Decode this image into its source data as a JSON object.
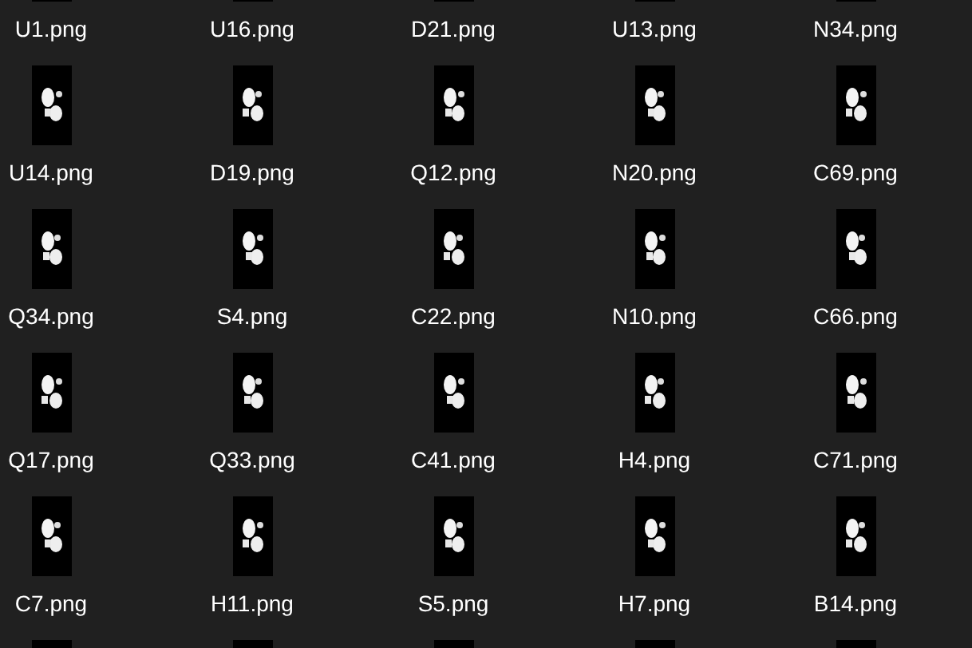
{
  "files": [
    {
      "kind": "file",
      "name": "U1.png"
    },
    {
      "kind": "file",
      "name": "U16.png"
    },
    {
      "kind": "file",
      "name": "D21.png"
    },
    {
      "kind": "file",
      "name": "U13.png"
    },
    {
      "kind": "file",
      "name": "N34.png"
    },
    {
      "kind": "file",
      "name": "U14.png"
    },
    {
      "kind": "file",
      "name": "D19.png"
    },
    {
      "kind": "file",
      "name": "Q12.png"
    },
    {
      "kind": "file",
      "name": "N20.png"
    },
    {
      "kind": "file",
      "name": "C69.png"
    },
    {
      "kind": "file",
      "name": "Q34.png"
    },
    {
      "kind": "file",
      "name": "S4.png"
    },
    {
      "kind": "file",
      "name": "C22.png"
    },
    {
      "kind": "file",
      "name": "N10.png"
    },
    {
      "kind": "file",
      "name": "C66.png"
    },
    {
      "kind": "file",
      "name": "Q17.png"
    },
    {
      "kind": "file",
      "name": "Q33.png"
    },
    {
      "kind": "file",
      "name": "C41.png"
    },
    {
      "kind": "file",
      "name": "H4.png"
    },
    {
      "kind": "file",
      "name": "C71.png"
    },
    {
      "kind": "file",
      "name": "C7.png"
    },
    {
      "kind": "file",
      "name": "H11.png"
    },
    {
      "kind": "file",
      "name": "S5.png"
    },
    {
      "kind": "file",
      "name": "H7.png"
    },
    {
      "kind": "file",
      "name": "B14.png"
    },
    {
      "kind": "picture"
    },
    {
      "kind": "picture"
    },
    {
      "kind": "picture"
    },
    {
      "kind": "picture"
    },
    {
      "kind": "picture"
    }
  ]
}
